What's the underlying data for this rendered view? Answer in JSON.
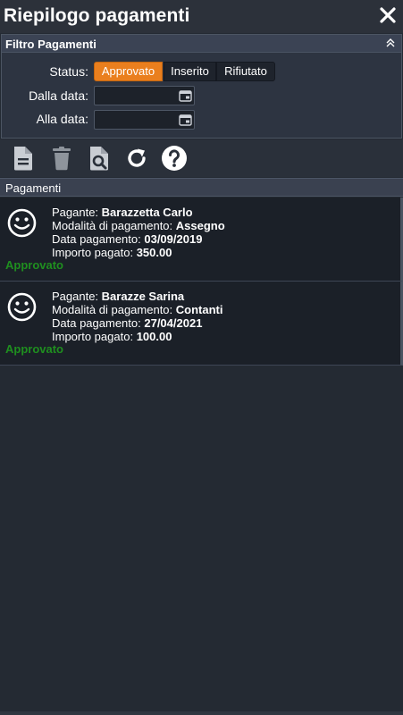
{
  "window": {
    "title": "Riepilogo pagamenti",
    "close_icon": "close-icon"
  },
  "filter": {
    "title": "Filtro Pagamenti",
    "collapse_icon": "chevron-double-up-icon",
    "status_label": "Status:",
    "status_options": [
      "Approvato",
      "Inserito",
      "Rifiutato"
    ],
    "status_selected": "Approvato",
    "from_label": "Dalla data:",
    "from_value": "",
    "to_label": "Alla data:",
    "to_value": "",
    "calendar_icon": "calendar-icon"
  },
  "toolbar": {
    "icons": [
      "new-document-icon",
      "trash-icon",
      "document-search-icon",
      "refresh-icon",
      "help-icon"
    ]
  },
  "list": {
    "title": "Pagamenti",
    "labels": {
      "payer": "Pagante:",
      "method": "Modalità di pagamento:",
      "date": "Data pagamento:",
      "amount": "Importo pagato:"
    },
    "items": [
      {
        "payer": "Barazzetta Carlo",
        "method": "Assegno",
        "date": "03/09/2019",
        "amount": "350.00",
        "status": "Approvato"
      },
      {
        "payer": "Barazze Sarina",
        "method": "Contanti",
        "date": "27/04/2021",
        "amount": "100.00",
        "status": "Approvato"
      }
    ]
  },
  "colors": {
    "accent": "#ea7f1e",
    "status_approved": "#1f8f1f",
    "background": "#242a33"
  }
}
